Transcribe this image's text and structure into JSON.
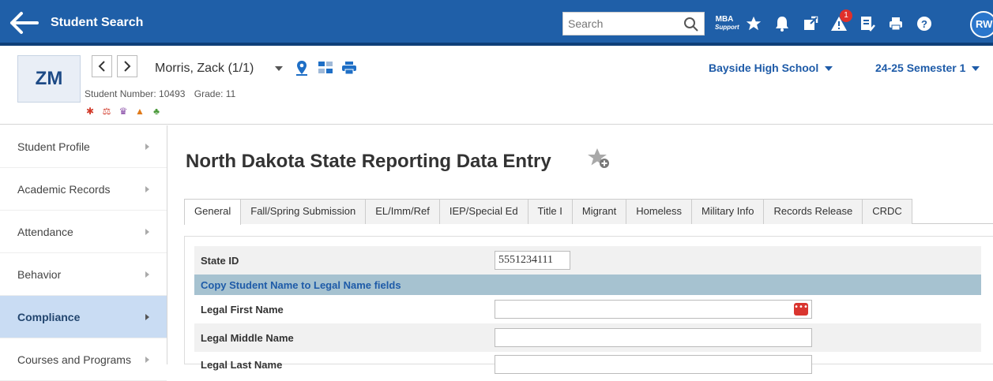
{
  "app": {
    "title": "Student Search"
  },
  "search": {
    "placeholder": "Search"
  },
  "header_icons": {
    "mba_line1": "MBA",
    "mba_line2": "Support",
    "notif_count": "1",
    "user_initials": "RW"
  },
  "student": {
    "initials": "ZM",
    "name": "Morris, Zack  (1/1)",
    "number_label": "Student Number: 10493",
    "grade_label": "Grade: 11"
  },
  "context": {
    "school": "Bayside High School",
    "term": "24-25 Semester 1"
  },
  "sidebar": {
    "items": [
      {
        "label": "Student Profile"
      },
      {
        "label": "Academic Records"
      },
      {
        "label": "Attendance"
      },
      {
        "label": "Behavior"
      },
      {
        "label": "Compliance"
      },
      {
        "label": "Courses and Programs"
      }
    ],
    "active_index": 4
  },
  "page": {
    "title": "North Dakota State Reporting Data Entry"
  },
  "tabs": [
    {
      "label": "General"
    },
    {
      "label": "Fall/Spring Submission"
    },
    {
      "label": "EL/Imm/Ref"
    },
    {
      "label": "IEP/Special Ed"
    },
    {
      "label": "Title I"
    },
    {
      "label": "Migrant"
    },
    {
      "label": "Homeless"
    },
    {
      "label": "Military Info"
    },
    {
      "label": "Records Release"
    },
    {
      "label": "CRDC"
    }
  ],
  "form": {
    "state_id_label": "State ID",
    "state_id_value": "5551234111",
    "copy_banner": "Copy Student Name to Legal Name fields",
    "legal_first_label": "Legal First Name",
    "legal_first_value": "",
    "legal_middle_label": "Legal Middle Name",
    "legal_middle_value": "",
    "legal_last_label": "Legal Last Name",
    "legal_last_value": ""
  },
  "colors": {
    "header_bg": "#1f5fa8",
    "active_side": "#c9dcf3",
    "banner": "#a6c2d0",
    "link_blue": "#1e5ba8"
  }
}
